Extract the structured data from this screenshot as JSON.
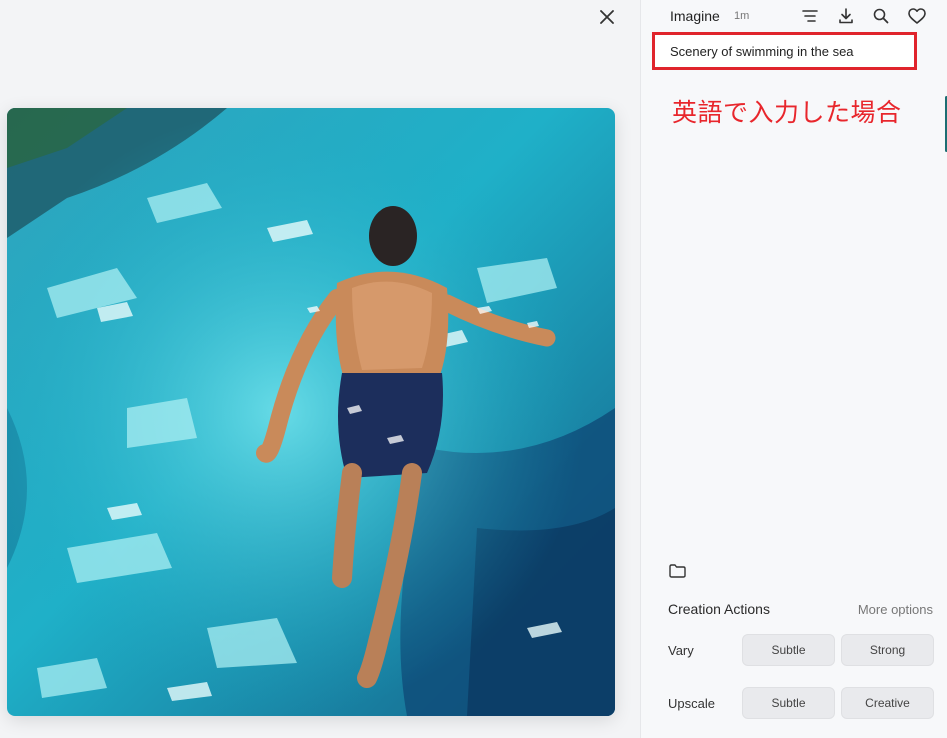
{
  "viewer": {
    "close_icon": "close-icon",
    "image_icon": "swimmer-painting"
  },
  "header": {
    "app_name": "Imagine",
    "time_ago": "1m",
    "icons": [
      "filter-lines-icon",
      "download-icon",
      "search-icon",
      "heart-icon"
    ]
  },
  "prompt": {
    "text": "Scenery of swimming in the sea"
  },
  "annotation": {
    "text": "英語で入力した場合",
    "color": "#e8262c"
  },
  "folder": {
    "icon": "folder-icon"
  },
  "actions": {
    "title": "Creation Actions",
    "more_options": "More options",
    "vary": {
      "label": "Vary",
      "subtle": "Subtle",
      "strong": "Strong"
    },
    "upscale": {
      "label": "Upscale",
      "subtle": "Subtle",
      "creative": "Creative"
    }
  },
  "colors": {
    "highlight_border": "#e0242c",
    "panel_bg": "#f7f8fa",
    "button_bg": "#e9eaed"
  }
}
